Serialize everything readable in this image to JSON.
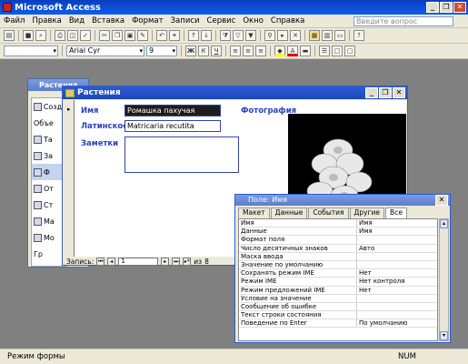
{
  "app": {
    "title": "Microsoft Access"
  },
  "menu": {
    "items": [
      "Файл",
      "Правка",
      "Вид",
      "Вставка",
      "Формат",
      "Записи",
      "Сервис",
      "Окно",
      "Справка"
    ],
    "help_placeholder": "Введите вопрос"
  },
  "toolbar": {
    "font_name": "Arial Cyr",
    "font_size": "9"
  },
  "db_window": {
    "title": "Растения",
    "items": [
      "Созда",
      "Объе",
      "Та",
      "За",
      "Ф",
      "От",
      "Ст",
      "Ма",
      "Мо",
      "Гр"
    ]
  },
  "form": {
    "title": "Растения",
    "labels": {
      "name": "Имя",
      "latin": "Латинское И",
      "notes": "Заметки",
      "photo": "Фотография"
    },
    "values": {
      "name": "Ромашка пахучая",
      "latin": "Matricaria recutita",
      "notes": ""
    },
    "nav": {
      "label": "Запись:",
      "current": "1",
      "total": "8",
      "of": "из"
    }
  },
  "property_sheet": {
    "title": "Поле: Имя",
    "tabs": [
      "Макет",
      "Данные",
      "События",
      "Другие",
      "Все"
    ],
    "active_tab": "Все",
    "rows": [
      {
        "name": "Имя",
        "value": "Имя"
      },
      {
        "name": "Данные",
        "value": "Имя"
      },
      {
        "name": "Формат поля",
        "value": ""
      },
      {
        "name": "Число десятичных знаков",
        "value": "Авто"
      },
      {
        "name": "Маска ввода",
        "value": ""
      },
      {
        "name": "Значение по умолчанию",
        "value": ""
      },
      {
        "name": "Сохранять режим IME",
        "value": "Нет"
      },
      {
        "name": "Режим IME",
        "value": "Нет контроля"
      },
      {
        "name": "Режим предложений IME",
        "value": "Нет"
      },
      {
        "name": "Условие на значение",
        "value": ""
      },
      {
        "name": "Сообщение об ошибке",
        "value": ""
      },
      {
        "name": "Текст строки состояния",
        "value": ""
      },
      {
        "name": "Поведение по Enter",
        "value": "По умолчанию"
      }
    ]
  },
  "status": {
    "left": "Режим формы",
    "num": "NUM"
  }
}
